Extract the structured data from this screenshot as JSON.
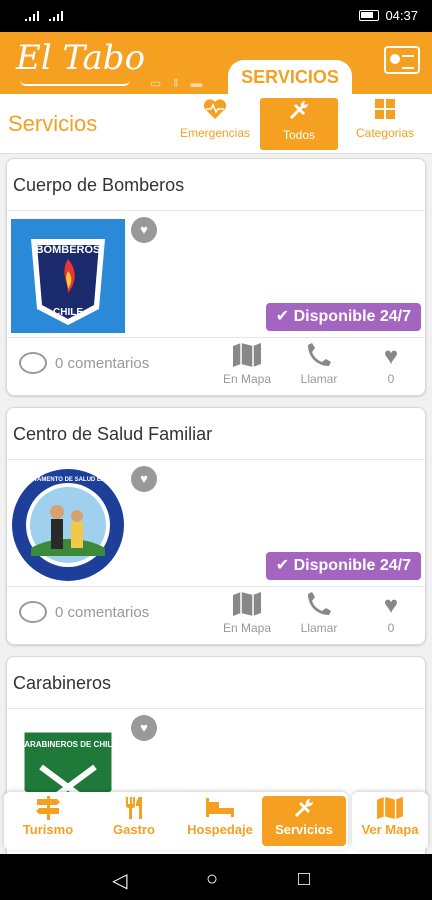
{
  "status_bar": {
    "time": "04:37"
  },
  "header": {
    "logo_text": "El Tabo",
    "active_tab": "SERVICIOS"
  },
  "subheader": {
    "title": "Servicios",
    "filters": [
      {
        "label": "Emergencias",
        "icon": "heartbeat-icon"
      },
      {
        "label": "Todos",
        "icon": "tools-icon",
        "active": true
      },
      {
        "label": "Categorias",
        "icon": "grid-icon"
      }
    ]
  },
  "cards": [
    {
      "title": "Cuerpo de Bomberos",
      "badge": "Disponible 24/7",
      "comments": "0 comentarios",
      "map_label": "En Mapa",
      "call_label": "Llamar",
      "fav_count": "0",
      "logo": {
        "top": "BOMBEROS",
        "bottom": "CHILE"
      }
    },
    {
      "title": "Centro de Salud Familiar",
      "badge": "Disponible 24/7",
      "comments": "0 comentarios",
      "map_label": "En Mapa",
      "call_label": "Llamar",
      "fav_count": "0",
      "logo": {
        "top": "DEPARTAMENTO DE SALUD EL TABO"
      }
    },
    {
      "title": "Carabineros",
      "logo": {
        "top": "CARABINEROS DE CHILE"
      }
    }
  ],
  "bottom_nav": {
    "items": [
      {
        "label": "Turismo",
        "icon": "signpost-icon"
      },
      {
        "label": "Gastro",
        "icon": "cutlery-icon"
      },
      {
        "label": "Hospedaje",
        "icon": "bed-icon"
      },
      {
        "label": "Servicios",
        "icon": "tools-icon",
        "active": true
      }
    ],
    "map_button": "Ver Mapa"
  },
  "colors": {
    "brand": "#f5a020",
    "badge": "#a465c0"
  }
}
